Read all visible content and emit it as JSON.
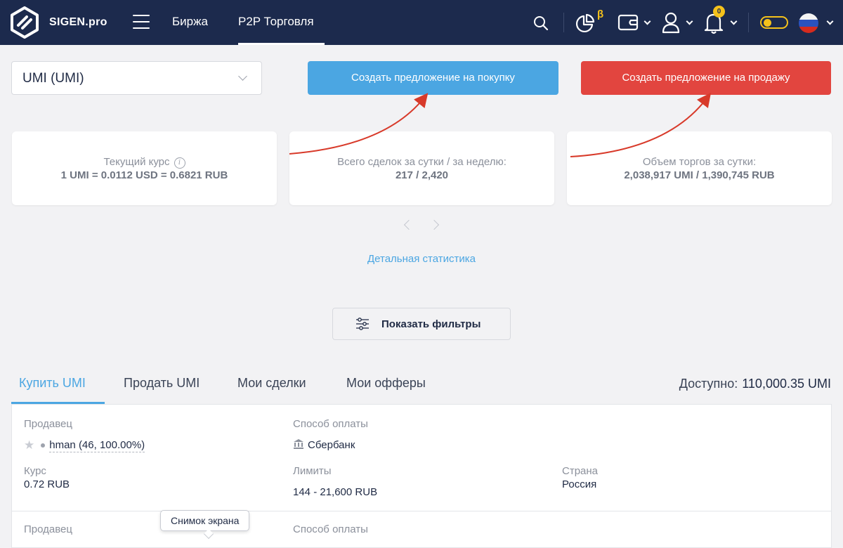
{
  "header": {
    "logo_text": "SIGEN.pro",
    "nav": [
      {
        "label": "Биржа"
      },
      {
        "label": "P2P Торговля",
        "active": true
      }
    ],
    "beta_mark": "β",
    "notifications_count": "0",
    "icons": [
      "logo-icon",
      "menu-icon",
      "search-icon",
      "pie-chart-icon",
      "wallet-icon",
      "user-icon",
      "bell-icon",
      "theme-toggle",
      "flag-ru-icon"
    ],
    "colors": {
      "bar": "#1c2a4d",
      "accent": "#f5c21b"
    }
  },
  "currency_select": {
    "value": "UMI (UMI)"
  },
  "actions": {
    "buy_label": "Создать предложение на покупку",
    "sell_label": "Создать предложение на продажу",
    "buy_color": "#4ba6e2",
    "sell_color": "#e2453f"
  },
  "stats": [
    {
      "label": "Текущий курс",
      "value": "1 UMI = 0.0112 USD = 0.6821 RUB"
    },
    {
      "label": "Всего сделок за сутки / за неделю:",
      "value": "217 / 2,420"
    },
    {
      "label": "Объем торгов за сутки:",
      "value": "2,038,917 UMI / 1,390,745 RUB"
    }
  ],
  "stats_link": "Детальная статистика",
  "filter_button": "Показать фильтры",
  "tabs": [
    {
      "label": "Купить UMI",
      "active": true
    },
    {
      "label": "Продать UMI"
    },
    {
      "label": "Мои сделки"
    },
    {
      "label": "Мои офферы"
    }
  ],
  "available": {
    "label": "Доступно:",
    "value": "110,000.35 UMI"
  },
  "listings": [
    {
      "seller_label": "Продавец",
      "seller": "hman (46, 100.00%)",
      "payment_label": "Способ оплаты",
      "payment": "Сбербанк",
      "rate_label": "Курс",
      "rate": "0.72 RUB",
      "limits_label": "Лимиты",
      "limits": "144 - 21,600 RUB",
      "country_label": "Страна",
      "country": "Россия"
    },
    {
      "seller_label": "Продавец",
      "payment_label": "Способ оплаты"
    }
  ],
  "tooltip": "Снимок экрана"
}
